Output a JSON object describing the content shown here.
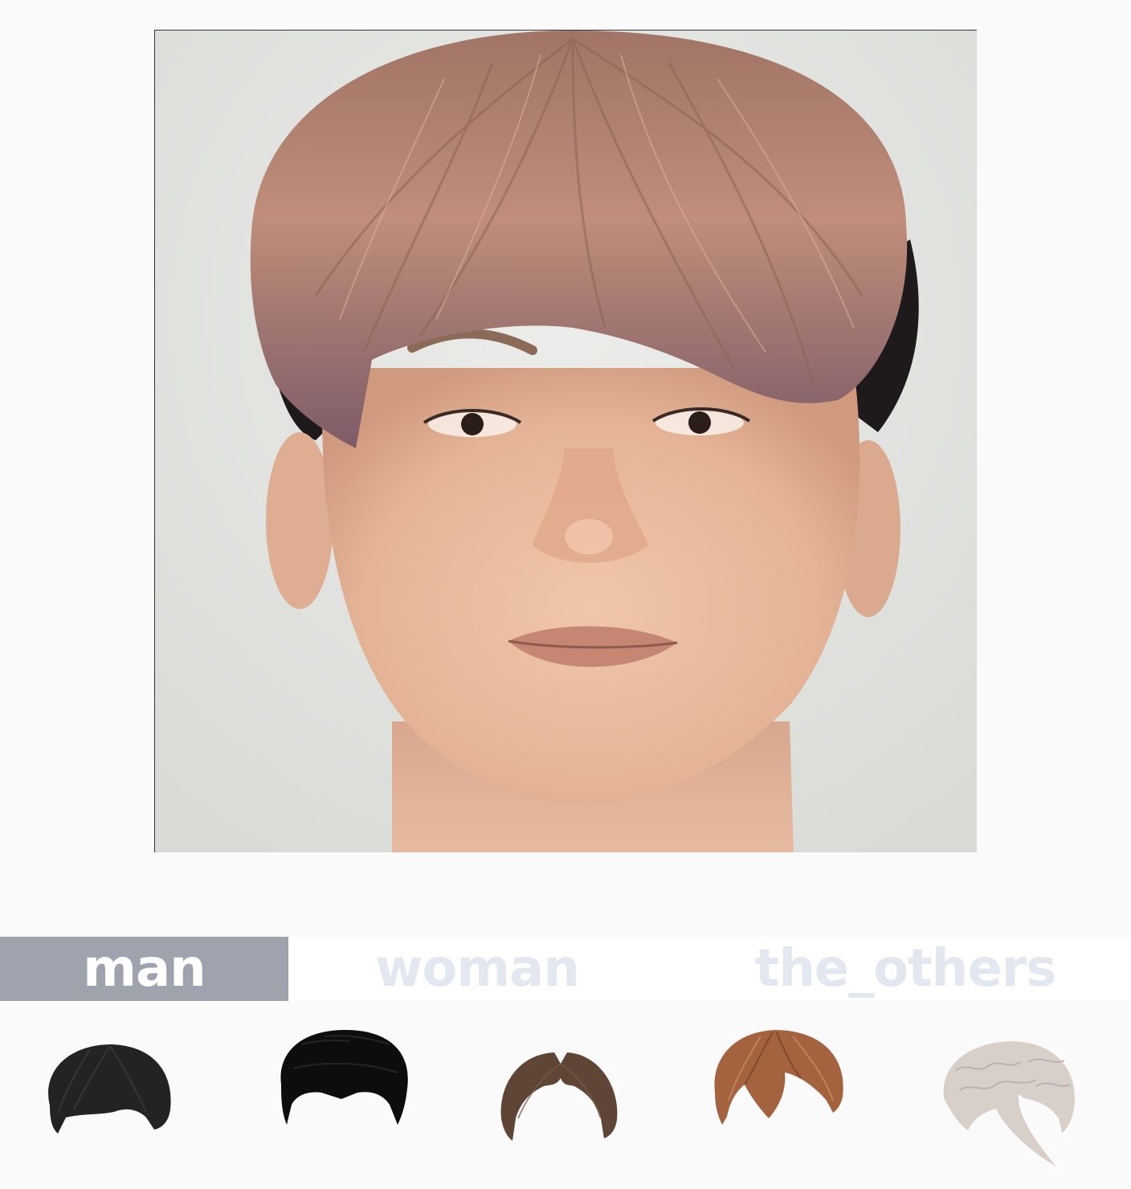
{
  "tabs": [
    {
      "label": "man",
      "active": true
    },
    {
      "label": "woman",
      "active": false
    },
    {
      "label": "the_others",
      "active": false
    }
  ],
  "colors": {
    "active_tab_bg": "#9ea3ae",
    "active_tab_text": "#ffffff",
    "inactive_tab_text": "#e3e7ef",
    "preview_hair": "#b98a78",
    "preview_skin": "#e9bea2",
    "background": "#fafafa"
  },
  "hairstyles": [
    {
      "name": "black-short-hair",
      "color": "#232323"
    },
    {
      "name": "black-fluffy-hair",
      "color": "#0d0d0d"
    },
    {
      "name": "brown-parted-hair",
      "color": "#5e4536"
    },
    {
      "name": "auburn-bowl-hair",
      "color": "#a5623f"
    },
    {
      "name": "platinum-wavy-hair",
      "color": "#d9cfc9"
    }
  ]
}
